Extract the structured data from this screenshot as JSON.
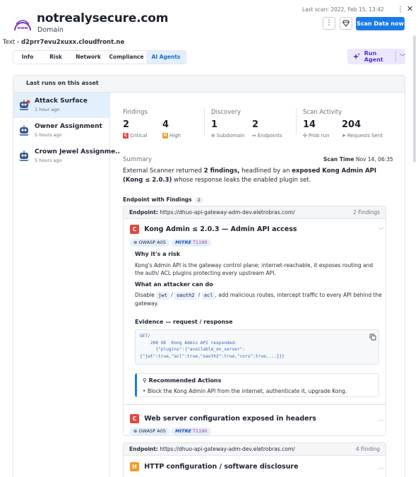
{
  "header": {
    "domain_name": "notrealysecure.com",
    "domain_type": "Domain",
    "logo_text": "www",
    "last_scan": "Last scan: 2022, Feb 15, 13:42",
    "scan_button": "Scan Data now"
  },
  "breadcrumb": {
    "parent": "Text",
    "current": "d2prr7evu2xuxx.cloudfront.ne"
  },
  "tabs": [
    {
      "label": "Info"
    },
    {
      "label": "Risk"
    },
    {
      "label": "Network"
    },
    {
      "label": "Compliance"
    },
    {
      "label": "AI Agents",
      "active": true
    }
  ],
  "run_agent": {
    "label": "Run Agent"
  },
  "panel": {
    "title": "Last runs on this asset"
  },
  "runs": [
    {
      "title": "Attack Surface",
      "time": "1 hour ago",
      "active": true
    },
    {
      "title": "Owner Assignment",
      "time": "5 hours ago"
    },
    {
      "title": "Crown Jewel Assignme..",
      "time": "5 hours ago"
    }
  ],
  "stats": {
    "findings": {
      "label": "Findings",
      "critical_count": "2",
      "critical_label": "Critical",
      "critical_badge": "C",
      "high_count": "4",
      "high_label": "High",
      "high_badge": "H"
    },
    "discovery": {
      "label": "Discovery",
      "subdomain_count": "1",
      "subdomain_label": "Subdomain",
      "endpoint_count": "2",
      "endpoint_label": "Endpoints"
    },
    "activity": {
      "label": "Scan Activity",
      "probe_count": "14",
      "probe_label": "Prob run",
      "request_count": "204",
      "request_label": "Requests Sent"
    }
  },
  "summary": {
    "label": "Summary",
    "scan_time_label": "Scan Time",
    "scan_time": "Nov 14, 06:35",
    "text_1": "External Scanner returned ",
    "text_bold_1": "2 findings,",
    "text_2": " headlined by an ",
    "text_bold_2": "exposed Kong Admin API (Kong ≤ 2.0.3)",
    "text_3": " whose response leaks the enabled plugin set."
  },
  "endpoints_section": {
    "title": "Endpoint with Findings",
    "count": "2"
  },
  "endpoint_1": {
    "label": "Endpoint:",
    "url": "https://dhuo-api-gateway-adm-dev.eletrobras.com/",
    "count": "2 Findings",
    "finding_1": {
      "severity": "C",
      "title": "Kong Admin ≤ 2.0.3 — Admin API access",
      "tag_owasp": "OWASP A05",
      "tag_mitre": "MITRE",
      "tag_mitre_id": "T1190",
      "why_title": "Why it's a risk",
      "why_text": "Kong's Admin API is the gateway control plane; internet-reachable, it exposes routing and the auth/ ACL plugins protecting every upstream API.",
      "attack_title": "What an attacker can do",
      "attack_pre": "Disable",
      "chip_1": "jwt",
      "chip_2": "oauth2",
      "chip_3": "acl",
      "slash": "/",
      "attack_post": ", add malicious routes, intercept traffic to every API behind the gateway.",
      "evidence_title": "Evidence — request / response",
      "code_l1": "GET/",
      "code_l2": "    200 OK  Kong Admin API responded:",
      "code_l3": "      {\"plugins\":{\"available_on_server\":",
      "code_l4": "{\"jwt\":true,\"acl\":true,\"oauth2\":true,\"cors\":true,...}}}",
      "rec_title": "Recommended Actions",
      "rec_item": "Block the Kong Admin API from the internet, authenticate it, upgrade Kong."
    },
    "finding_2": {
      "severity": "C",
      "title": "Web server configuration exposed in headers",
      "tag_owasp": "OWASP A05",
      "tag_mitre": "MITRE",
      "tag_mitre_id": "T1190"
    }
  },
  "endpoint_2": {
    "label": "Endpoint:",
    "url": "https://dhuo-api-gateway-adm-dev.eletrobras.com/",
    "count": "4 Finding",
    "finding_1": {
      "severity": "H",
      "title": "HTTP configuration / software disclosure"
    }
  }
}
